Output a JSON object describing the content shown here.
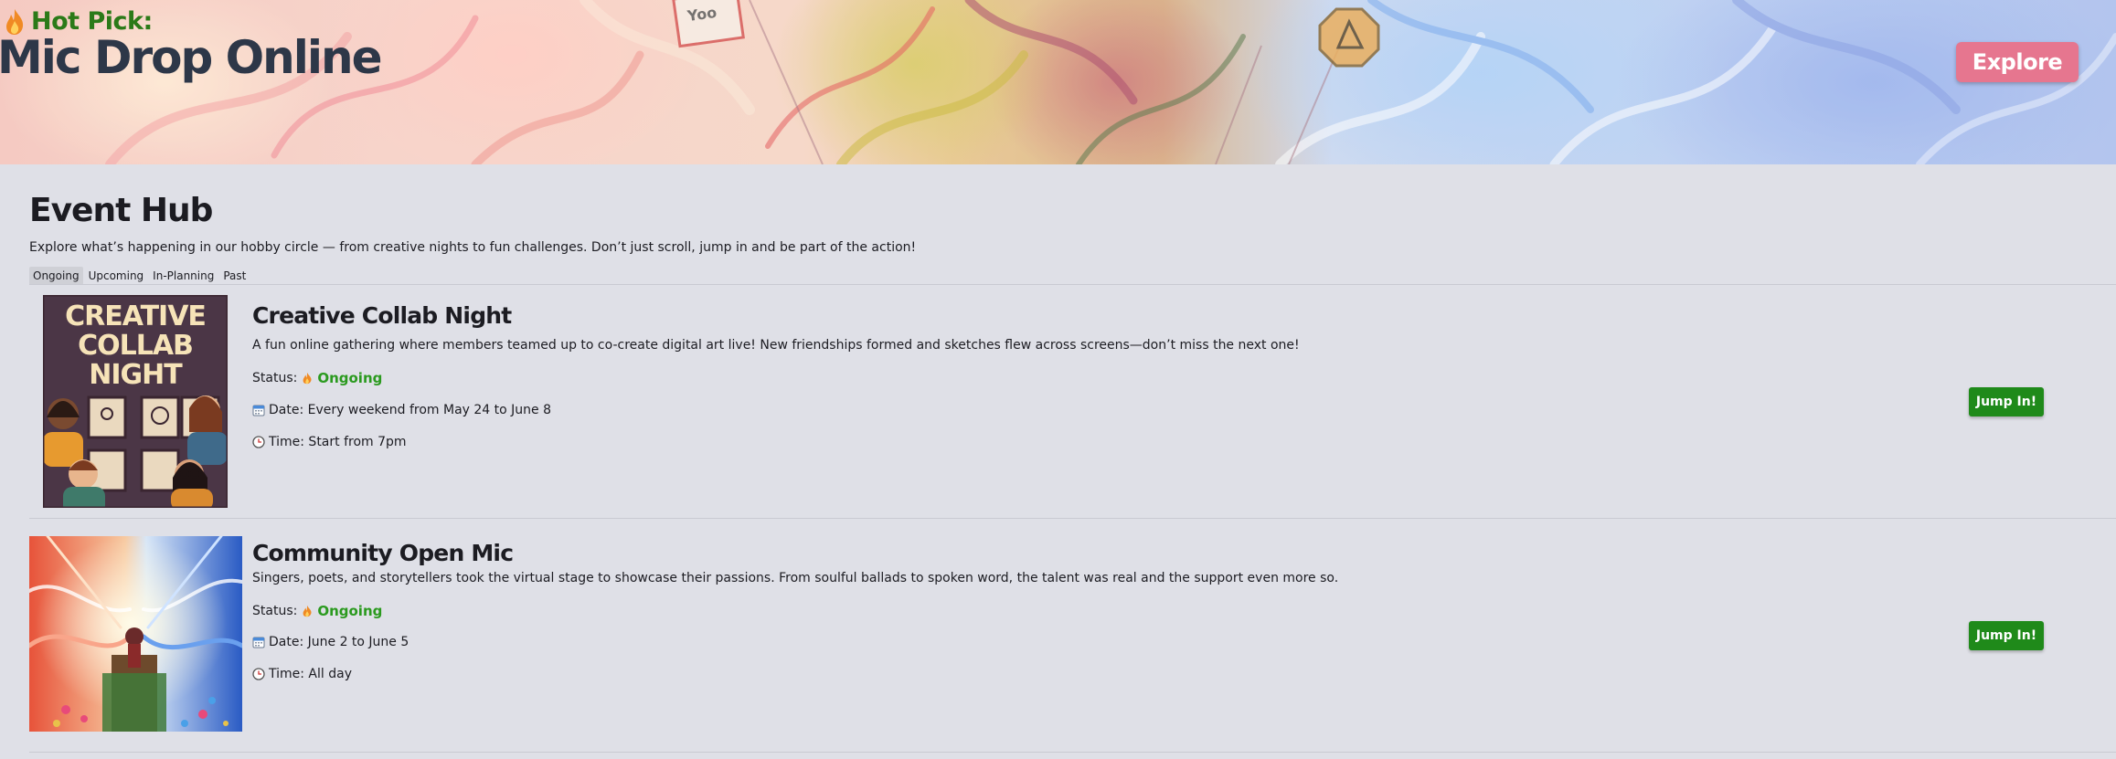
{
  "hero": {
    "kicker": "Hot Pick:",
    "title": "Mic Drop Online",
    "explore_label": "Explore",
    "sign_text": "Yoo"
  },
  "hub": {
    "title": "Event Hub",
    "description": "Explore what’s happening in our hobby circle — from creative nights to fun challenges. Don’t just scroll, jump in and be part of the action!",
    "tabs": [
      {
        "label": "Ongoing",
        "active": true
      },
      {
        "label": "Upcoming",
        "active": false
      },
      {
        "label": "In-Planning",
        "active": false
      },
      {
        "label": "Past",
        "active": false
      }
    ]
  },
  "events": [
    {
      "title": "Creative Collab Night",
      "description": "A fun online gathering where members teamed up to co-create digital art live! New friendships formed and sketches flew across screens—don’t miss the next one!",
      "status_label": "Status:",
      "status_value": "Ongoing",
      "date": "Date: Every weekend from May 24 to June 8",
      "time": "Time: Start from 7pm",
      "button_label": "Jump In!",
      "poster_lines": [
        "CREATIVE",
        "COLLAB",
        "NIGHT"
      ]
    },
    {
      "title": "Community Open Mic",
      "description": "Singers, poets, and storytellers took the virtual stage to showcase their passions. From soulful ballads to spoken word, the talent was real and the support even more so.",
      "status_label": "Status:",
      "status_value": "Ongoing",
      "date": "Date: June 2 to June 5",
      "time": "Time: All day",
      "button_label": "Jump In!"
    }
  ],
  "colors": {
    "kicker": "#2b7a18",
    "hero_title": "#2d3748",
    "explore_bg": "#e6768f",
    "status_ongoing": "#2b9a1f",
    "jump_bg": "#1f8a1a",
    "page_bg": "#dfe0e7"
  }
}
